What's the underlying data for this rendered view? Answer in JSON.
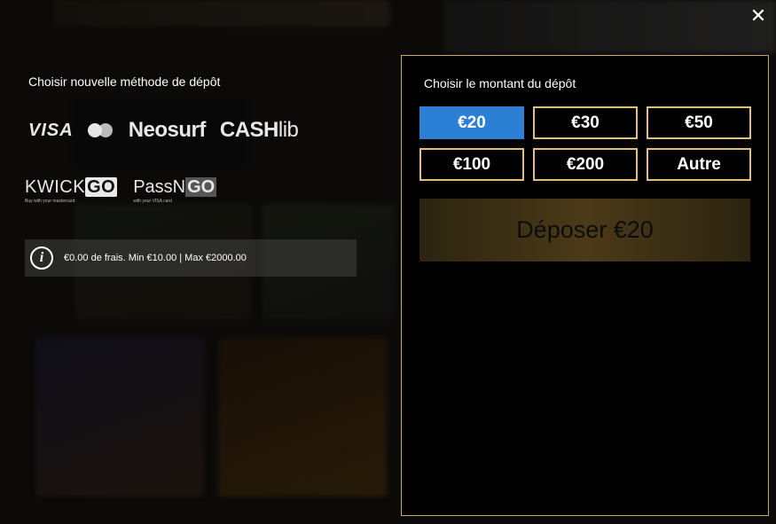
{
  "close_label": "✕",
  "left": {
    "title": "Choisir nouvelle méthode de dépôt",
    "methods_row1": {
      "visa": "VISA",
      "neosurf": "Neosurf",
      "cashlib_a": "CASH",
      "cashlib_b": "lib"
    },
    "methods_row2": {
      "kwick_main": "KWICK",
      "kwick_go": "GO",
      "kwick_sub": "Buy with your  mastercard",
      "passn_main": "PassN",
      "passn_go": "GO",
      "passn_sub": "with your VISA card"
    },
    "info": {
      "icon": "i",
      "text": "€0.00 de frais. Min €10.00 | Max €2000.00"
    }
  },
  "panel": {
    "title": "Choisir le montant du dépôt",
    "amounts": [
      "€20",
      "€30",
      "€50",
      "€100",
      "€200",
      "Autre"
    ],
    "selected": "€20",
    "deposit_label": "Déposer €20"
  },
  "colors": {
    "accent_blue": "#2b7fd4",
    "gold_border": "#e2c079"
  }
}
